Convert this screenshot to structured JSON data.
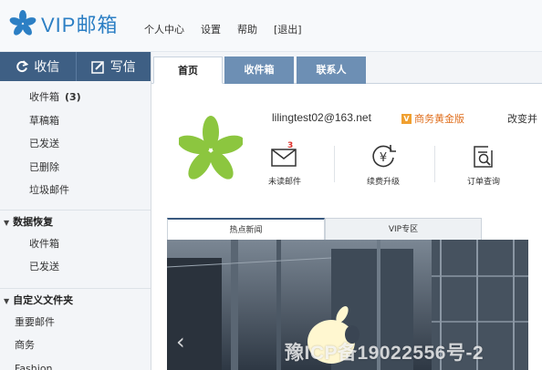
{
  "header": {
    "brand": "VIP邮箱",
    "links": [
      "个人中心",
      "设置",
      "帮助",
      "[退出]"
    ]
  },
  "sidebar": {
    "actions": [
      {
        "label": "收信",
        "icon": "refresh-icon"
      },
      {
        "label": "写信",
        "icon": "compose-icon"
      }
    ],
    "folders": [
      {
        "label": "收件箱",
        "count": "(3)"
      },
      {
        "label": "草稿箱"
      },
      {
        "label": "已发送"
      },
      {
        "label": "已删除"
      },
      {
        "label": "垃圾邮件"
      }
    ],
    "recovery": {
      "title": "数据恢复",
      "items": [
        "收件箱",
        "已发送"
      ]
    },
    "custom": {
      "title": "自定义文件夹",
      "items": [
        "重要邮件",
        "商务",
        "Fashion"
      ]
    }
  },
  "tabs": [
    {
      "label": "首页",
      "active": true
    },
    {
      "label": "收件箱",
      "active": false
    },
    {
      "label": "联系人",
      "active": false
    }
  ],
  "account": {
    "email": "lilingtest02@163.net",
    "vip_label": "商务黄金版",
    "vip_mark": "V",
    "change_link": "改变并",
    "quick_actions": [
      {
        "label": "未读邮件",
        "icon": "envelope-icon",
        "badge": "3"
      },
      {
        "label": "续费升级",
        "icon": "yuan-upgrade-icon"
      },
      {
        "label": "订单查询",
        "icon": "order-search-icon"
      }
    ]
  },
  "news": {
    "tabs": [
      "热点新闻",
      "VIP专区"
    ],
    "prev_arrow": "‹"
  },
  "watermark": "豫ICP备19022556号-2",
  "colors": {
    "sidebar_button": "#3e5f84",
    "inactive_tab": "#6d8fb4",
    "brand_blue": "#2c7fc4",
    "avatar_green": "#8cc63f",
    "vip_orange": "#e07020",
    "badge_red": "#e0302a"
  }
}
